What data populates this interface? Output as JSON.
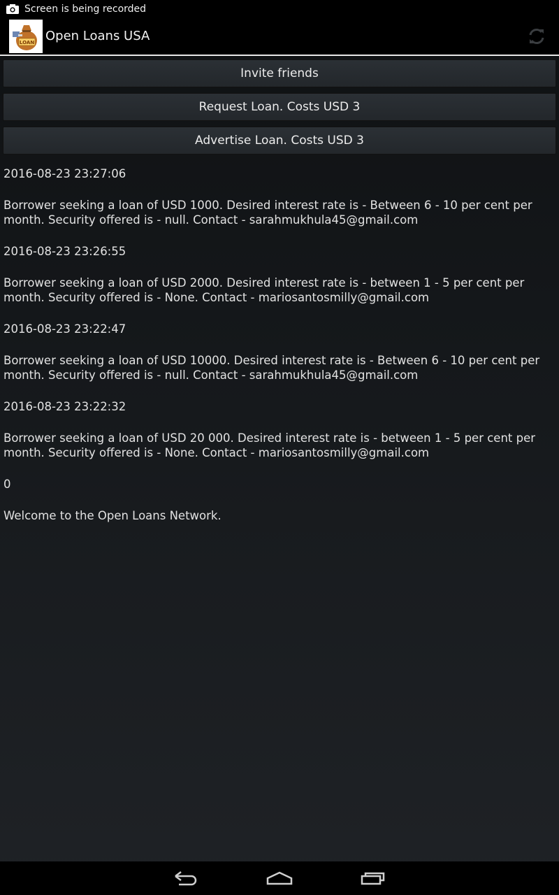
{
  "status_bar": {
    "text": "Screen is being recorded",
    "icon": "camera-icon"
  },
  "action_bar": {
    "title": "Open Loans USA",
    "app_icon_text": "LOAN",
    "refresh_icon": "refresh-icon"
  },
  "buttons": {
    "invite": "Invite friends",
    "request": "Request Loan. Costs USD 3",
    "advertise": "Advertise Loan. Costs USD 3"
  },
  "feed": [
    {
      "timestamp": "2016-08-23 23:27:06",
      "message": "Borrower seeking a loan of USD 1000. Desired interest rate is - Between 6 - 10 per cent per month. Security offered is - null. Contact - sarahmukhula45@gmail.com"
    },
    {
      "timestamp": "2016-08-23 23:26:55",
      "message": "Borrower seeking a loan of USD 2000. Desired interest rate is - between 1 - 5 per cent per month. Security offered is - None. Contact - mariosantosmilly@gmail.com"
    },
    {
      "timestamp": "2016-08-23 23:22:47",
      "message": "Borrower seeking a loan of USD 10000. Desired interest rate is - Between 6 - 10 per cent per month. Security offered is - null. Contact - sarahmukhula45@gmail.com"
    },
    {
      "timestamp": "2016-08-23 23:22:32",
      "message": "Borrower seeking a loan of USD 20 000. Desired interest rate is - between 1 - 5 per cent per month. Security offered is - None. Contact - mariosantosmilly@gmail.com"
    },
    {
      "timestamp": "0",
      "message": "Welcome to the Open Loans Network."
    }
  ],
  "nav": {
    "back": "back-icon",
    "home": "home-icon",
    "recents": "recents-icon"
  }
}
